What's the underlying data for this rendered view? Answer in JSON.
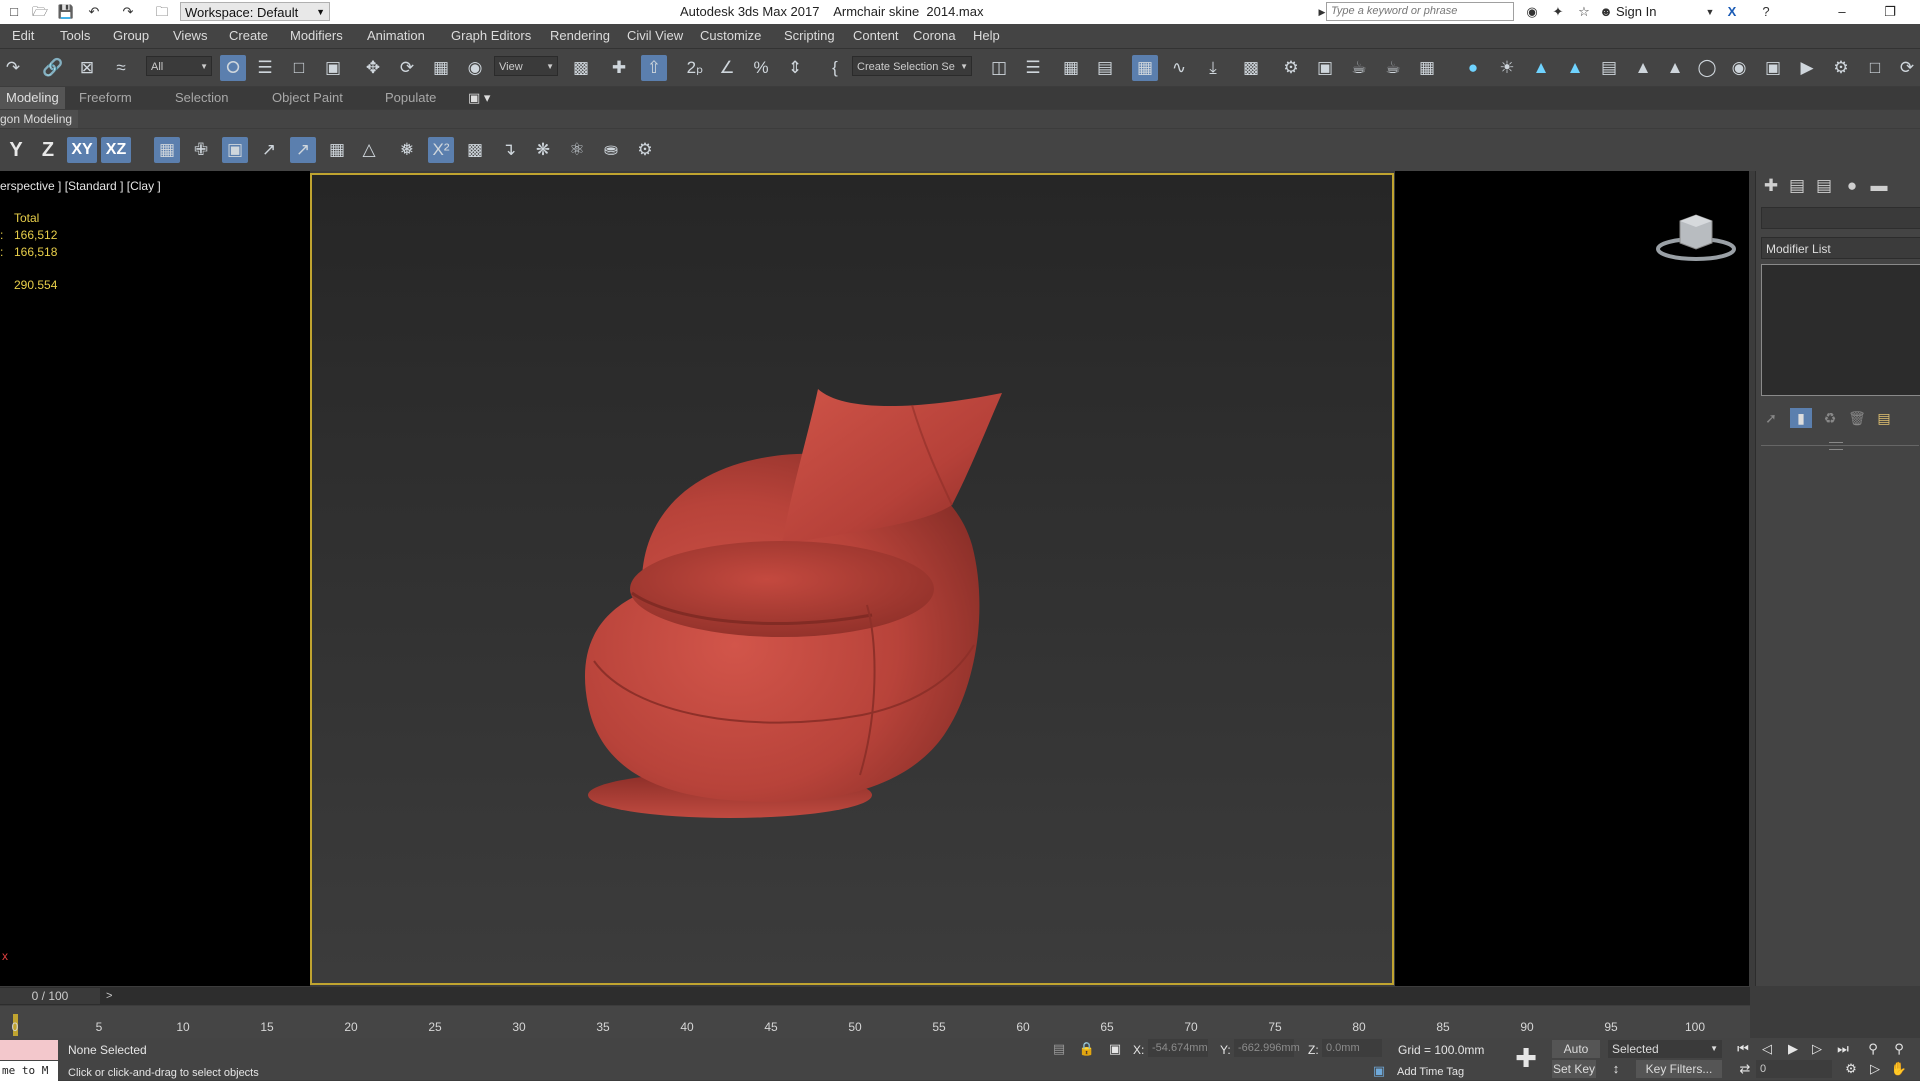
{
  "titlebar": {
    "workspace_label": "Workspace: Default",
    "app_title": "Autodesk 3ds Max 2017    Armchair skine  2014.max",
    "search_placeholder": "Type a keyword or phrase",
    "sign_in": "Sign In",
    "minimize": "–",
    "restore": "❐"
  },
  "menu": [
    "Edit",
    "Tools",
    "Group",
    "Views",
    "Create",
    "Modifiers",
    "Animation",
    "Graph Editors",
    "Rendering",
    "Civil View",
    "Customize",
    "Scripting",
    "Content",
    "Corona",
    "Help"
  ],
  "toolbar": {
    "filter_value": "All",
    "refcoord_value": "View",
    "named_selection": "Create Selection Se"
  },
  "ribbon": {
    "tabs": [
      "Modeling",
      "Freeform",
      "Selection",
      "Object Paint",
      "Populate"
    ],
    "active_tab": "Modeling",
    "sub_label": "gon Modeling"
  },
  "axis": {
    "y": "Y",
    "z": "Z",
    "xy": "XY",
    "xz": "XZ"
  },
  "viewport": {
    "label": "erspective ] [Standard ] [Clay ]",
    "stats_header": "Total",
    "polys": "166,512",
    "verts": "166,518",
    "fps": "290.554",
    "axis_mark": "x"
  },
  "command_panel": {
    "modifier_list": "Modifier List"
  },
  "timeline": {
    "frame": "0 / 100",
    "next": ">",
    "ticks": [
      "0",
      "5",
      "10",
      "15",
      "20",
      "25",
      "30",
      "35",
      "40",
      "45",
      "50",
      "55",
      "60",
      "65",
      "70",
      "75",
      "80",
      "85",
      "90",
      "95",
      "100"
    ]
  },
  "status": {
    "maxscript_text": "me to M",
    "selection": "None Selected",
    "prompt": "Click or click-and-drag to select objects",
    "x_label": "X:",
    "x_value": "-54.674mm",
    "y_label": "Y:",
    "y_value": "-662.996mm",
    "z_label": "Z:",
    "z_value": "0.0mm",
    "grid": "Grid = 100.0mm",
    "add_time_tag": "Add Time Tag",
    "auto_key": "Auto Key",
    "set_key": "Set Key",
    "selected": "Selected",
    "key_filters": "Key Filters...",
    "current_frame": "0"
  },
  "colors": {
    "viewport_border": "#c0a430",
    "stats_text": "#e8cf4a",
    "active_blue": "#5b7fae",
    "chair": "#c6473c"
  }
}
